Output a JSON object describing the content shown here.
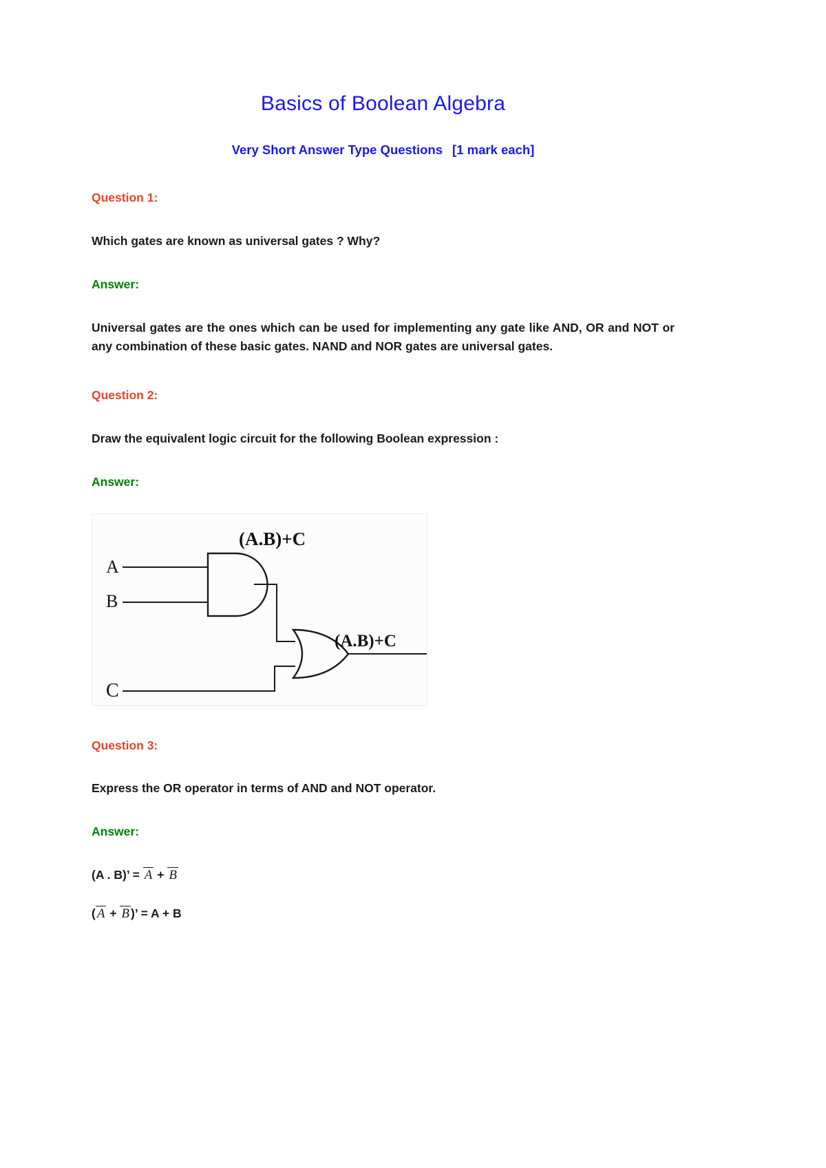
{
  "document": {
    "title": "Basics of Boolean Algebra",
    "subtitle_main": "Very Short Answer Type Questions",
    "subtitle_marks": "[1 mark each]"
  },
  "colors": {
    "title_blue": "#1818f0",
    "question_orange": "#e8432a",
    "answer_green": "#008000",
    "body_black": "#1a1a1a",
    "page_background": "#ffffff"
  },
  "sections": [
    {
      "question_label": "Question 1:",
      "question_text": "Which gates are known as universal gates ? Why?",
      "answer_label": "Answer:",
      "answer_text": "Universal gates are the ones which can be used for implementing any gate like AND, OR and NOT or any combination of these basic gates. NAND and NOR gates are universal gates."
    },
    {
      "question_label": "Question 2:",
      "question_text": "Draw the equivalent logic circuit for the following Boolean expression :",
      "answer_label": "Answer:"
    },
    {
      "question_label": "Question 3:",
      "question_text": "Express the OR operator in terms of AND and NOT operator.",
      "answer_label": "Answer:"
    }
  ],
  "circuit": {
    "caption_top": "(A.B)+C",
    "output_label": "(A.B)+C",
    "input_a": "A",
    "input_b": "B",
    "input_c": "C",
    "gate1_type": "AND",
    "gate2_type": "OR"
  },
  "formulas": {
    "line1": {
      "lhs": "(A . B)’ =",
      "term1": "A",
      "operator": "+",
      "term2": "B"
    },
    "line2": {
      "open": "(",
      "term1": "A",
      "operator": "+",
      "term2": "B",
      "close": ")’ = A + B"
    }
  }
}
